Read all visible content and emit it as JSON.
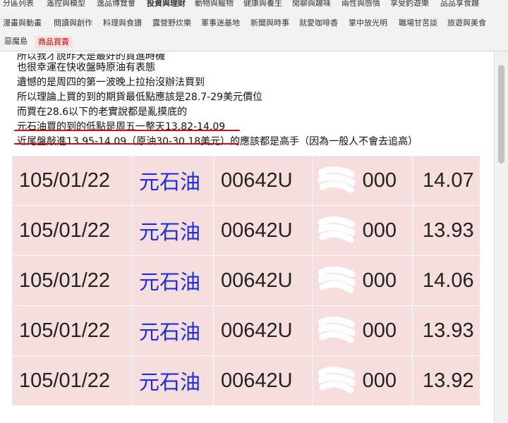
{
  "nav": {
    "row1": [
      "分區列表",
      "遙控與模型",
      "逸品博覽會",
      "投資與理財",
      "動物與寵物",
      "健康與養生",
      "閒聊與趣味",
      "兩性與感情",
      "享受釣遊樂",
      "品品享食趣"
    ],
    "row2": [
      "漫畫與動畫",
      "閱讀與創作",
      "料理與食譜",
      "露營野炊樂",
      "軍事迷基地",
      "新聞與時事",
      "就愛咖啡香",
      "掌中放光明",
      "職場甘苦談",
      "旅遊與美食"
    ],
    "row3": [
      "惡魔島",
      "商品買賣"
    ]
  },
  "post": {
    "lines": [
      "所以我才說昨天是最好的買進時機",
      "也很幸運在快收盤時原油有表態",
      "遺憾的是周四的第一波晚上拉抬沒辦法買到",
      "所以理論上買的到的期貨最低點應該是28.7-29美元價位",
      "而買在28.6以下的老實說都是亂摸底的",
      "元石油買的到的低點是周五一整天13.82-14.09",
      "近尾盤敲進13.95-14.09（原油30-30.18美元）的應該都是高手（因為一般人不會去追高）"
    ]
  },
  "trades": {
    "rows": [
      {
        "date": "105/01/22",
        "name": "元石油",
        "code": "00642U",
        "amount": "000",
        "price": "14.07"
      },
      {
        "date": "105/01/22",
        "name": "元石油",
        "code": "00642U",
        "amount": "000",
        "price": "13.93"
      },
      {
        "date": "105/01/22",
        "name": "元石油",
        "code": "00642U",
        "amount": "000",
        "price": "14.06"
      },
      {
        "date": "105/01/22",
        "name": "元石油",
        "code": "00642U",
        "amount": "000",
        "price": "13.93"
      },
      {
        "date": "105/01/22",
        "name": "元石油",
        "code": "00642U",
        "amount": "000",
        "price": "13.92"
      }
    ]
  },
  "colors": {
    "nav_active": "#c40000",
    "underline": "#cc1111",
    "stock_name": "#1c2ee0",
    "cell_bg": "#f7dede"
  }
}
